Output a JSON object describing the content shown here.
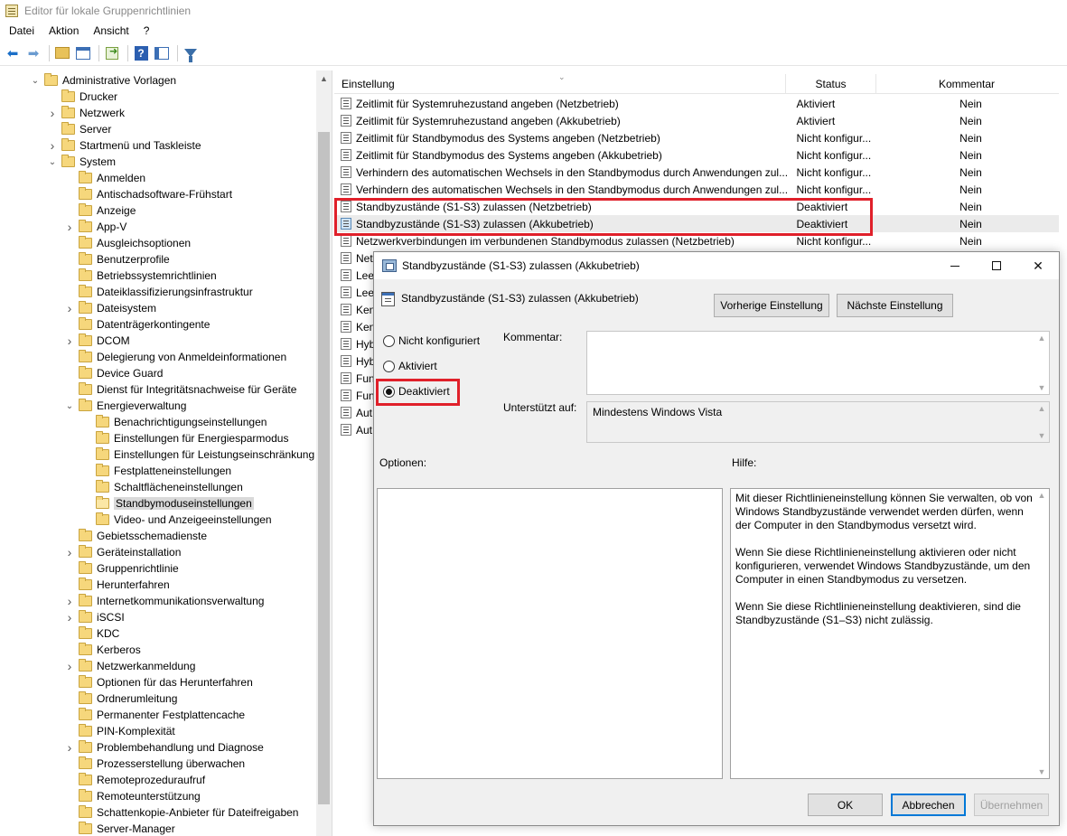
{
  "window": {
    "title": "Editor für lokale Gruppenrichtlinien"
  },
  "menu": [
    "Datei",
    "Aktion",
    "Ansicht",
    "?"
  ],
  "tree": [
    {
      "label": "Administrative Vorlagen",
      "level": 0,
      "chevron": "open"
    },
    {
      "label": "Drucker",
      "level": 1,
      "chevron": ""
    },
    {
      "label": "Netzwerk",
      "level": 1,
      "chevron": "closed"
    },
    {
      "label": "Server",
      "level": 1,
      "chevron": ""
    },
    {
      "label": "Startmenü und Taskleiste",
      "level": 1,
      "chevron": "closed"
    },
    {
      "label": "System",
      "level": 1,
      "chevron": "open"
    },
    {
      "label": "Anmelden",
      "level": 2,
      "chevron": ""
    },
    {
      "label": "Antischadsoftware-Frühstart",
      "level": 2,
      "chevron": ""
    },
    {
      "label": "Anzeige",
      "level": 2,
      "chevron": ""
    },
    {
      "label": "App-V",
      "level": 2,
      "chevron": "closed"
    },
    {
      "label": "Ausgleichsoptionen",
      "level": 2,
      "chevron": ""
    },
    {
      "label": "Benutzerprofile",
      "level": 2,
      "chevron": ""
    },
    {
      "label": "Betriebssystemrichtlinien",
      "level": 2,
      "chevron": ""
    },
    {
      "label": "Dateiklassifizierungsinfrastruktur",
      "level": 2,
      "chevron": ""
    },
    {
      "label": "Dateisystem",
      "level": 2,
      "chevron": "closed"
    },
    {
      "label": "Datenträgerkontingente",
      "level": 2,
      "chevron": ""
    },
    {
      "label": "DCOM",
      "level": 2,
      "chevron": "closed"
    },
    {
      "label": "Delegierung von Anmeldeinformationen",
      "level": 2,
      "chevron": ""
    },
    {
      "label": "Device Guard",
      "level": 2,
      "chevron": ""
    },
    {
      "label": "Dienst für Integritätsnachweise für Geräte",
      "level": 2,
      "chevron": ""
    },
    {
      "label": "Energieverwaltung",
      "level": 2,
      "chevron": "open"
    },
    {
      "label": "Benachrichtigungseinstellungen",
      "level": 3,
      "chevron": ""
    },
    {
      "label": "Einstellungen für Energiesparmodus",
      "level": 3,
      "chevron": ""
    },
    {
      "label": "Einstellungen für Leistungseinschränkung",
      "level": 3,
      "chevron": ""
    },
    {
      "label": "Festplatteneinstellungen",
      "level": 3,
      "chevron": ""
    },
    {
      "label": "Schaltflächeneinstellungen",
      "level": 3,
      "chevron": ""
    },
    {
      "label": "Standbymoduseinstellungen",
      "level": 3,
      "chevron": "",
      "selected": true
    },
    {
      "label": "Video- und Anzeigeeinstellungen",
      "level": 3,
      "chevron": ""
    },
    {
      "label": "Gebietsschemadienste",
      "level": 2,
      "chevron": ""
    },
    {
      "label": "Geräteinstallation",
      "level": 2,
      "chevron": "closed"
    },
    {
      "label": "Gruppenrichtlinie",
      "level": 2,
      "chevron": ""
    },
    {
      "label": "Herunterfahren",
      "level": 2,
      "chevron": ""
    },
    {
      "label": "Internetkommunikationsverwaltung",
      "level": 2,
      "chevron": "closed"
    },
    {
      "label": "iSCSI",
      "level": 2,
      "chevron": "closed"
    },
    {
      "label": "KDC",
      "level": 2,
      "chevron": ""
    },
    {
      "label": "Kerberos",
      "level": 2,
      "chevron": ""
    },
    {
      "label": "Netzwerkanmeldung",
      "level": 2,
      "chevron": "closed"
    },
    {
      "label": "Optionen für das Herunterfahren",
      "level": 2,
      "chevron": ""
    },
    {
      "label": "Ordnerumleitung",
      "level": 2,
      "chevron": ""
    },
    {
      "label": "Permanenter Festplattencache",
      "level": 2,
      "chevron": ""
    },
    {
      "label": "PIN-Komplexität",
      "level": 2,
      "chevron": ""
    },
    {
      "label": "Problembehandlung und Diagnose",
      "level": 2,
      "chevron": "closed"
    },
    {
      "label": "Prozesserstellung überwachen",
      "level": 2,
      "chevron": ""
    },
    {
      "label": "Remoteprozeduraufruf",
      "level": 2,
      "chevron": ""
    },
    {
      "label": "Remoteunterstützung",
      "level": 2,
      "chevron": ""
    },
    {
      "label": "Schattenkopie-Anbieter für Dateifreigaben",
      "level": 2,
      "chevron": ""
    },
    {
      "label": "Server-Manager",
      "level": 2,
      "chevron": ""
    }
  ],
  "list": {
    "columns": [
      "Einstellung",
      "Status",
      "Kommentar"
    ],
    "rows": [
      {
        "name": "Zeitlimit für Systemruhezustand angeben (Netzbetrieb)",
        "status": "Aktiviert",
        "comment": "Nein"
      },
      {
        "name": "Zeitlimit für Systemruhezustand angeben (Akkubetrieb)",
        "status": "Aktiviert",
        "comment": "Nein"
      },
      {
        "name": "Zeitlimit für Standbymodus des Systems angeben (Netzbetrieb)",
        "status": "Nicht konfigur...",
        "comment": "Nein"
      },
      {
        "name": "Zeitlimit für Standbymodus des Systems angeben (Akkubetrieb)",
        "status": "Nicht konfigur...",
        "comment": "Nein"
      },
      {
        "name": "Verhindern des automatischen Wechsels in den Standbymodus durch Anwendungen zul...",
        "status": "Nicht konfigur...",
        "comment": "Nein"
      },
      {
        "name": "Verhindern des automatischen Wechsels in den Standbymodus durch Anwendungen zul...",
        "status": "Nicht konfigur...",
        "comment": "Nein"
      },
      {
        "name": "Standbyzustände (S1-S3) zulassen (Netzbetrieb)",
        "status": "Deaktiviert",
        "comment": "Nein"
      },
      {
        "name": "Standbyzustände (S1-S3) zulassen (Akkubetrieb)",
        "status": "Deaktiviert",
        "comment": "Nein",
        "selected": true
      },
      {
        "name": "Netzwerkverbindungen im verbundenen Standbymodus zulassen (Netzbetrieb)",
        "status": "Nicht konfigur...",
        "comment": "Nein"
      },
      {
        "name": "Net",
        "status": "",
        "comment": ""
      },
      {
        "name": "Lee",
        "status": "",
        "comment": ""
      },
      {
        "name": "Lee",
        "status": "",
        "comment": ""
      },
      {
        "name": "Ken",
        "status": "",
        "comment": ""
      },
      {
        "name": "Ken",
        "status": "",
        "comment": ""
      },
      {
        "name": "Hyb",
        "status": "",
        "comment": ""
      },
      {
        "name": "Hyb",
        "status": "",
        "comment": ""
      },
      {
        "name": "Fun",
        "status": "",
        "comment": ""
      },
      {
        "name": "Fun",
        "status": "",
        "comment": ""
      },
      {
        "name": "Aut",
        "status": "",
        "comment": ""
      },
      {
        "name": "Aut",
        "status": "",
        "comment": ""
      }
    ]
  },
  "dialog": {
    "title": "Standbyzustände (S1-S3) zulassen (Akkubetrieb)",
    "heading": "Standbyzustände (S1-S3) zulassen (Akkubetrieb)",
    "prev_button": "Vorherige Einstellung",
    "next_button": "Nächste Einstellung",
    "radio_not_configured": "Nicht konfiguriert",
    "radio_enabled": "Aktiviert",
    "radio_disabled": "Deaktiviert",
    "selected_option": "Deaktiviert",
    "comment_label": "Kommentar:",
    "comment_value": "",
    "supported_label": "Unterstützt auf:",
    "supported_value": "Mindestens Windows Vista",
    "options_label": "Optionen:",
    "help_label": "Hilfe:",
    "help_paragraphs": [
      "Mit dieser Richtlinieneinstellung können Sie verwalten, ob von Windows Standbyzustände verwendet werden dürfen, wenn der Computer in den Standbymodus versetzt wird.",
      "Wenn Sie diese Richtlinieneinstellung aktivieren oder nicht konfigurieren, verwendet Windows Standbyzustände, um den Computer in einen Standbymodus zu versetzen.",
      "Wenn Sie diese Richtlinieneinstellung deaktivieren, sind die Standbyzustände (S1–S3) nicht zulässig."
    ],
    "ok_button": "OK",
    "cancel_button": "Abbrechen",
    "apply_button": "Übernehmen"
  },
  "colors": {
    "highlight_box": "#e0202a",
    "accent": "#0078d7"
  }
}
